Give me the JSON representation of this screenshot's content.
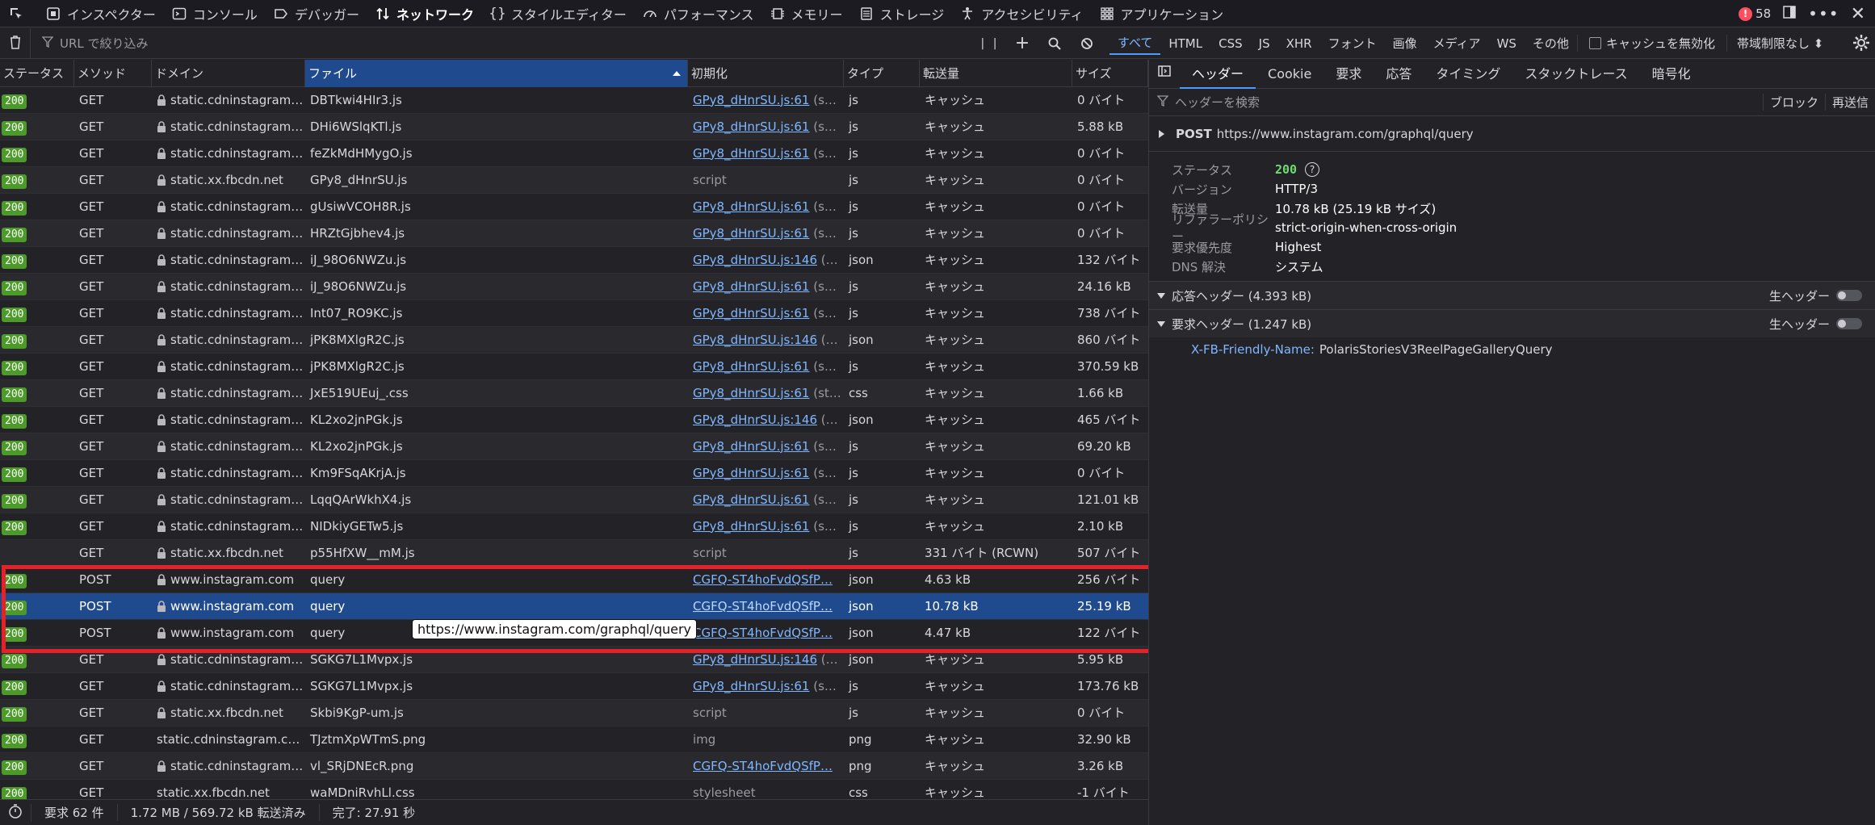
{
  "toolbar": {
    "tools": [
      {
        "name": "inspector",
        "label": "インスペクター",
        "icon": "inspector-icon"
      },
      {
        "name": "console",
        "label": "コンソール",
        "icon": "console-icon"
      },
      {
        "name": "debugger",
        "label": "デバッガー",
        "icon": "debugger-icon"
      },
      {
        "name": "network",
        "label": "ネットワーク",
        "icon": "network-icon",
        "active": true
      },
      {
        "name": "style-editor",
        "label": "スタイルエディター",
        "icon": "braces-icon"
      },
      {
        "name": "performance",
        "label": "パフォーマンス",
        "icon": "gauge-icon"
      },
      {
        "name": "memory",
        "label": "メモリー",
        "icon": "memory-icon"
      },
      {
        "name": "storage",
        "label": "ストレージ",
        "icon": "storage-icon"
      },
      {
        "name": "accessibility",
        "label": "アクセシビリティ",
        "icon": "accessibility-icon"
      },
      {
        "name": "application",
        "label": "アプリケーション",
        "icon": "grid-icon"
      }
    ],
    "error_count": "58"
  },
  "filter": {
    "placeholder": "URL で絞り込み",
    "types": [
      "すべて",
      "HTML",
      "CSS",
      "JS",
      "XHR",
      "フォント",
      "画像",
      "メディア",
      "WS",
      "その他"
    ],
    "disable_cache": "キャッシュを無効化",
    "throttling": "帯域制限なし ⬍"
  },
  "table": {
    "columns": [
      "ステータス",
      "メソッド",
      "ドメイン",
      "ファイル",
      "初期化",
      "タイプ",
      "転送量",
      "サイズ"
    ],
    "rows": [
      {
        "status": "200",
        "method": "GET",
        "domain": "static.cdninstagram.com",
        "lock": true,
        "file": "DBTkwi4HIr3.js",
        "init": "GPy8_dHnrSU.js:61",
        "init_suffix": " (s…",
        "init_link": true,
        "type": "js",
        "transfer": "キャッシュ",
        "size": "0 バイト"
      },
      {
        "status": "200",
        "method": "GET",
        "domain": "static.cdninstagram.com",
        "lock": true,
        "file": "DHi6WSlqKTl.js",
        "init": "GPy8_dHnrSU.js:61",
        "init_suffix": " (s…",
        "init_link": true,
        "type": "js",
        "transfer": "キャッシュ",
        "size": "5.88 kB"
      },
      {
        "status": "200",
        "method": "GET",
        "domain": "static.cdninstagram.com",
        "lock": true,
        "file": "feZkMdHMygO.js",
        "init": "GPy8_dHnrSU.js:61",
        "init_suffix": " (s…",
        "init_link": true,
        "type": "js",
        "transfer": "キャッシュ",
        "size": "0 バイト"
      },
      {
        "status": "200",
        "method": "GET",
        "domain": "static.xx.fbcdn.net",
        "lock": true,
        "file": "GPy8_dHnrSU.js",
        "init": "script",
        "init_suffix": "",
        "init_link": false,
        "type": "js",
        "transfer": "キャッシュ",
        "size": "0 バイト"
      },
      {
        "status": "200",
        "method": "GET",
        "domain": "static.cdninstagram.com",
        "lock": true,
        "file": "gUsiwVCOH8R.js",
        "init": "GPy8_dHnrSU.js:61",
        "init_suffix": " (s…",
        "init_link": true,
        "type": "js",
        "transfer": "キャッシュ",
        "size": "0 バイト"
      },
      {
        "status": "200",
        "method": "GET",
        "domain": "static.cdninstagram.com",
        "lock": true,
        "file": "HRZtGjbhev4.js",
        "init": "GPy8_dHnrSU.js:61",
        "init_suffix": " (s…",
        "init_link": true,
        "type": "js",
        "transfer": "キャッシュ",
        "size": "0 バイト"
      },
      {
        "status": "200",
        "method": "GET",
        "domain": "static.cdninstagram.com",
        "lock": true,
        "file": "iJ_98O6NWZu.js",
        "init": "GPy8_dHnrSU.js:146",
        "init_suffix": " (…",
        "init_link": true,
        "type": "json",
        "transfer": "キャッシュ",
        "size": "132 バイト"
      },
      {
        "status": "200",
        "method": "GET",
        "domain": "static.cdninstagram.com",
        "lock": true,
        "file": "iJ_98O6NWZu.js",
        "init": "GPy8_dHnrSU.js:61",
        "init_suffix": " (s…",
        "init_link": true,
        "type": "js",
        "transfer": "キャッシュ",
        "size": "24.16 kB"
      },
      {
        "status": "200",
        "method": "GET",
        "domain": "static.cdninstagram.com",
        "lock": true,
        "file": "Int07_RO9KC.js",
        "init": "GPy8_dHnrSU.js:61",
        "init_suffix": " (s…",
        "init_link": true,
        "type": "js",
        "transfer": "キャッシュ",
        "size": "738 バイト"
      },
      {
        "status": "200",
        "method": "GET",
        "domain": "static.cdninstagram.com",
        "lock": true,
        "file": "jPK8MXlgR2C.js",
        "init": "GPy8_dHnrSU.js:146",
        "init_suffix": " (…",
        "init_link": true,
        "type": "json",
        "transfer": "キャッシュ",
        "size": "860 バイト"
      },
      {
        "status": "200",
        "method": "GET",
        "domain": "static.cdninstagram.com",
        "lock": true,
        "file": "jPK8MXlgR2C.js",
        "init": "GPy8_dHnrSU.js:61",
        "init_suffix": " (s…",
        "init_link": true,
        "type": "js",
        "transfer": "キャッシュ",
        "size": "370.59 kB"
      },
      {
        "status": "200",
        "method": "GET",
        "domain": "static.cdninstagram.com",
        "lock": true,
        "file": "JxE519UEuj_.css",
        "init": "GPy8_dHnrSU.js:61",
        "init_suffix": " (st…",
        "init_link": true,
        "type": "css",
        "transfer": "キャッシュ",
        "size": "1.66 kB"
      },
      {
        "status": "200",
        "method": "GET",
        "domain": "static.cdninstagram.com",
        "lock": true,
        "file": "KL2xo2jnPGk.js",
        "init": "GPy8_dHnrSU.js:146",
        "init_suffix": " (…",
        "init_link": true,
        "type": "json",
        "transfer": "キャッシュ",
        "size": "465 バイト"
      },
      {
        "status": "200",
        "method": "GET",
        "domain": "static.cdninstagram.com",
        "lock": true,
        "file": "KL2xo2jnPGk.js",
        "init": "GPy8_dHnrSU.js:61",
        "init_suffix": " (s…",
        "init_link": true,
        "type": "js",
        "transfer": "キャッシュ",
        "size": "69.20 kB"
      },
      {
        "status": "200",
        "method": "GET",
        "domain": "static.cdninstagram.com",
        "lock": true,
        "file": "Km9FSqAKrjA.js",
        "init": "GPy8_dHnrSU.js:61",
        "init_suffix": " (s…",
        "init_link": true,
        "type": "js",
        "transfer": "キャッシュ",
        "size": "0 バイト"
      },
      {
        "status": "200",
        "method": "GET",
        "domain": "static.cdninstagram.com",
        "lock": true,
        "file": "LqqQArWkhX4.js",
        "init": "GPy8_dHnrSU.js:61",
        "init_suffix": " (s…",
        "init_link": true,
        "type": "js",
        "transfer": "キャッシュ",
        "size": "121.01 kB"
      },
      {
        "status": "200",
        "method": "GET",
        "domain": "static.cdninstagram.com",
        "lock": true,
        "file": "NIDkiyGETw5.js",
        "init": "GPy8_dHnrSU.js:61",
        "init_suffix": " (s…",
        "init_link": true,
        "type": "js",
        "transfer": "キャッシュ",
        "size": "2.10 kB"
      },
      {
        "status": "",
        "method": "GET",
        "domain": "static.xx.fbcdn.net",
        "lock": true,
        "file": "p55HfXW__mM.js",
        "init": "script",
        "init_suffix": "",
        "init_link": false,
        "type": "js",
        "transfer": "331 バイト (RCWN)",
        "size": "507 バイト"
      },
      {
        "status": "200",
        "method": "POST",
        "domain": "www.instagram.com",
        "lock": true,
        "file": "query",
        "init": "CGFQ-ST4hoFvdQSfP…",
        "init_suffix": "",
        "init_link": true,
        "type": "json",
        "transfer": "4.63 kB",
        "size": "256 バイト"
      },
      {
        "status": "200",
        "method": "POST",
        "domain": "www.instagram.com",
        "lock": true,
        "file": "query",
        "init": "CGFQ-ST4hoFvdQSfP…",
        "init_suffix": "",
        "init_link": true,
        "type": "json",
        "transfer": "10.78 kB",
        "size": "25.19 kB",
        "selected": true
      },
      {
        "status": "200",
        "method": "POST",
        "domain": "www.instagram.com",
        "lock": true,
        "file": "query",
        "init": "CGFQ-ST4hoFvdQSfP…",
        "init_suffix": "",
        "init_link": true,
        "type": "json",
        "transfer": "4.47 kB",
        "size": "122 バイト"
      },
      {
        "status": "200",
        "method": "GET",
        "domain": "static.cdninstagram.com",
        "lock": true,
        "file": "SGKG7L1Mvpx.js",
        "init": "GPy8_dHnrSU.js:146",
        "init_suffix": " (…",
        "init_link": true,
        "type": "json",
        "transfer": "キャッシュ",
        "size": "5.95 kB"
      },
      {
        "status": "200",
        "method": "GET",
        "domain": "static.cdninstagram.com",
        "lock": true,
        "file": "SGKG7L1Mvpx.js",
        "init": "GPy8_dHnrSU.js:61",
        "init_suffix": " (s…",
        "init_link": true,
        "type": "js",
        "transfer": "キャッシュ",
        "size": "173.76 kB"
      },
      {
        "status": "200",
        "method": "GET",
        "domain": "static.xx.fbcdn.net",
        "lock": true,
        "file": "Skbi9KgP-um.js",
        "init": "script",
        "init_suffix": "",
        "init_link": false,
        "type": "js",
        "transfer": "キャッシュ",
        "size": "0 バイト"
      },
      {
        "status": "200",
        "method": "GET",
        "domain": "static.cdninstagram.com",
        "lock": false,
        "file": "TJztmXpWTmS.png",
        "init": "img",
        "init_suffix": "",
        "init_link": false,
        "type": "png",
        "transfer": "キャッシュ",
        "size": "32.90 kB"
      },
      {
        "status": "200",
        "method": "GET",
        "domain": "static.cdninstagram.com",
        "lock": true,
        "file": "vl_SRjDNEcR.png",
        "init": "CGFQ-ST4hoFvdQSfP…",
        "init_suffix": "",
        "init_link": true,
        "type": "png",
        "transfer": "キャッシュ",
        "size": "3.26 kB"
      },
      {
        "status": "200",
        "method": "GET",
        "domain": "static.xx.fbcdn.net",
        "lock": false,
        "file": "waMDniRvhLl.css",
        "init": "stylesheet",
        "init_suffix": "",
        "init_link": false,
        "type": "css",
        "transfer": "キャッシュ",
        "size": "-1 バイト"
      }
    ],
    "tooltip": "https://www.instagram.com/graphql/query"
  },
  "status": {
    "requests": "要求 62 件",
    "transferred": "1.72 MB / 569.72 kB 転送済み",
    "finish": "完了: 27.91 秒"
  },
  "panel": {
    "tabs": [
      "ヘッダー",
      "Cookie",
      "要求",
      "応答",
      "タイミング",
      "スタックトレース",
      "暗号化"
    ],
    "search_placeholder": "ヘッダーを検索",
    "block": "ブロック",
    "resend": "再送信",
    "method": "POST",
    "url": "https://www.instagram.com/graphql/query",
    "details": [
      {
        "k": "ステータス",
        "v": "200"
      },
      {
        "k": "バージョン",
        "v": "HTTP/3"
      },
      {
        "k": "転送量",
        "v": "10.78 kB (25.19 kB サイズ)"
      },
      {
        "k": "リファラーポリシー",
        "v": "strict-origin-when-cross-origin"
      },
      {
        "k": "要求優先度",
        "v": "Highest"
      },
      {
        "k": "DNS 解決",
        "v": "システム"
      }
    ],
    "response_headers": "応答ヘッダー (4.393 kB)",
    "request_headers": "要求ヘッダー (1.247 kB)",
    "raw_toggle": "生ヘッダー",
    "header_name": "X-FB-Friendly-Name:",
    "header_value": "PolarisStoriesV3ReelPageGalleryQuery"
  },
  "colors": {
    "accent": "#4f9cff",
    "selected_row": "#1f4b8e",
    "status_ok": "#4c9a2a",
    "highlight": "#e3222a"
  }
}
